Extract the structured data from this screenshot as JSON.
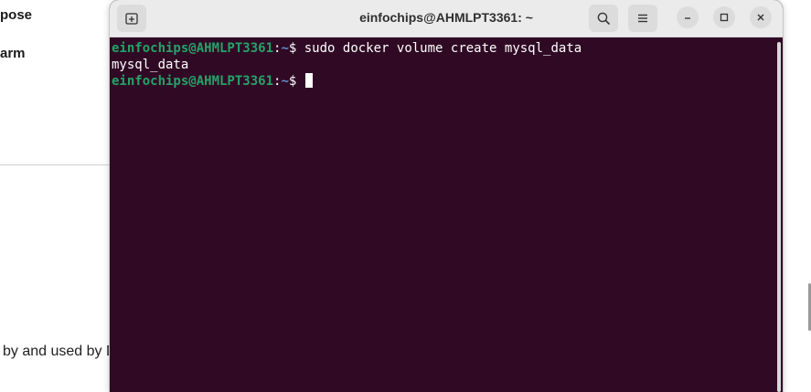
{
  "background_page": {
    "heading_1": "pose",
    "heading_2": "arm",
    "text_fragment": " by and used by D"
  },
  "terminal": {
    "title": "einfochips@AHMLPT3361: ~",
    "prompt_user": "einfochips@AHMLPT3361",
    "prompt_sep": ":",
    "prompt_path": "~",
    "prompt_symbol": "$ ",
    "lines": [
      {
        "type": "prompt",
        "command": "sudo docker volume create mysql_data"
      },
      {
        "type": "output",
        "text": "mysql_data"
      },
      {
        "type": "prompt",
        "command": ""
      }
    ],
    "colors": {
      "background": "#300a24",
      "prompt_user": "#26a269",
      "prompt_path": "#5e8fd6",
      "text": "#ffffff"
    }
  },
  "icons": {
    "new_tab": "new-tab-icon",
    "search": "search-icon",
    "menu": "hamburger-menu-icon",
    "minimize": "minimize-icon",
    "maximize": "maximize-icon",
    "close": "close-icon"
  }
}
